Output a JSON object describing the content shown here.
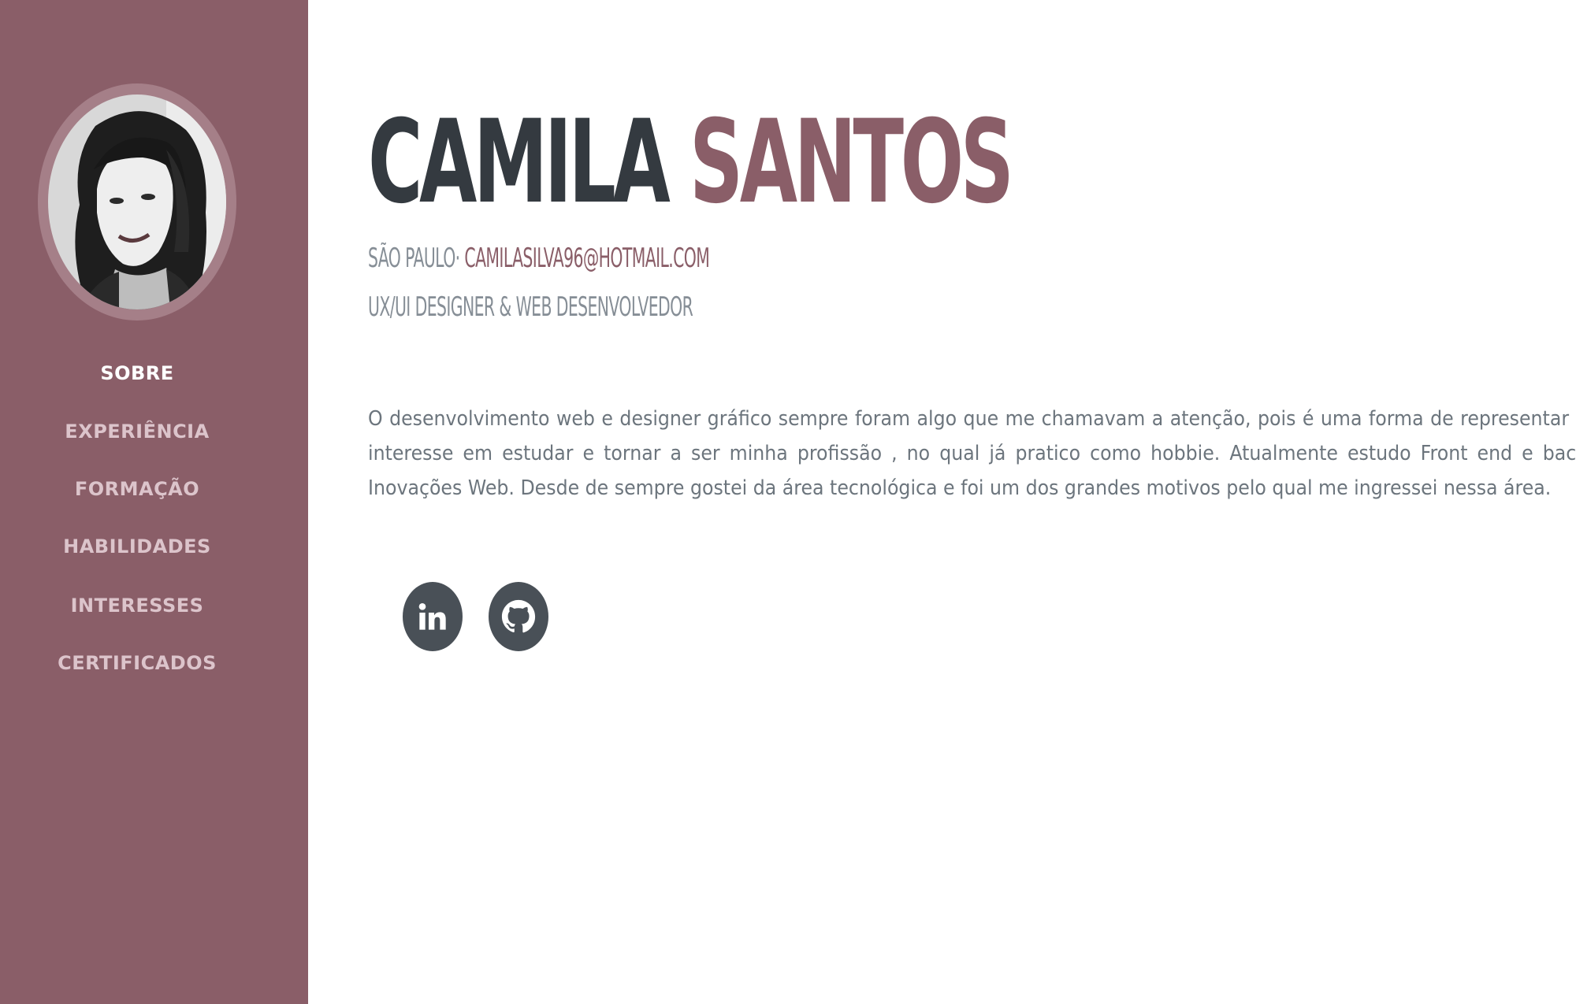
{
  "profile": {
    "first_name": "CAMILA",
    "last_name": "SANTOS",
    "location": "SÃO PAULO·",
    "email": "CAMILASILVA96@HOTMAIL.COM",
    "role": "UX/UI DESIGNER & WEB DESENVOLVEDOR",
    "bio": "O desenvolvimento web e designer gráfico sempre foram algo que me chamavam a atenção, pois é uma forma de representar o interesse em estudar e tornar a ser minha profissão , no qual já pratico como hobbie. Atualmente estudo Front end e back Inovações Web. Desde de sempre gostei da área tecnológica e foi um dos grandes motivos pelo qual me ingressei nessa área."
  },
  "nav": {
    "items": [
      {
        "label": "SOBRE",
        "active": true
      },
      {
        "label": "EXPERIÊNCIA",
        "active": false
      },
      {
        "label": "FORMAÇÃO",
        "active": false
      },
      {
        "label": "HABILIDADES",
        "active": false
      },
      {
        "label": "INTERESSES",
        "active": false
      },
      {
        "label": "CERTIFICADOS",
        "active": false
      }
    ]
  },
  "social": {
    "icons": [
      "linkedin-icon",
      "github-icon"
    ]
  },
  "colors": {
    "sidebar": "#8a5e68",
    "accent": "#8a5e68",
    "heading": "#343a40",
    "text": "#6c757d",
    "nav_text": "#dcc4cb",
    "nav_active": "#ffffff",
    "social_bg": "#495057"
  }
}
